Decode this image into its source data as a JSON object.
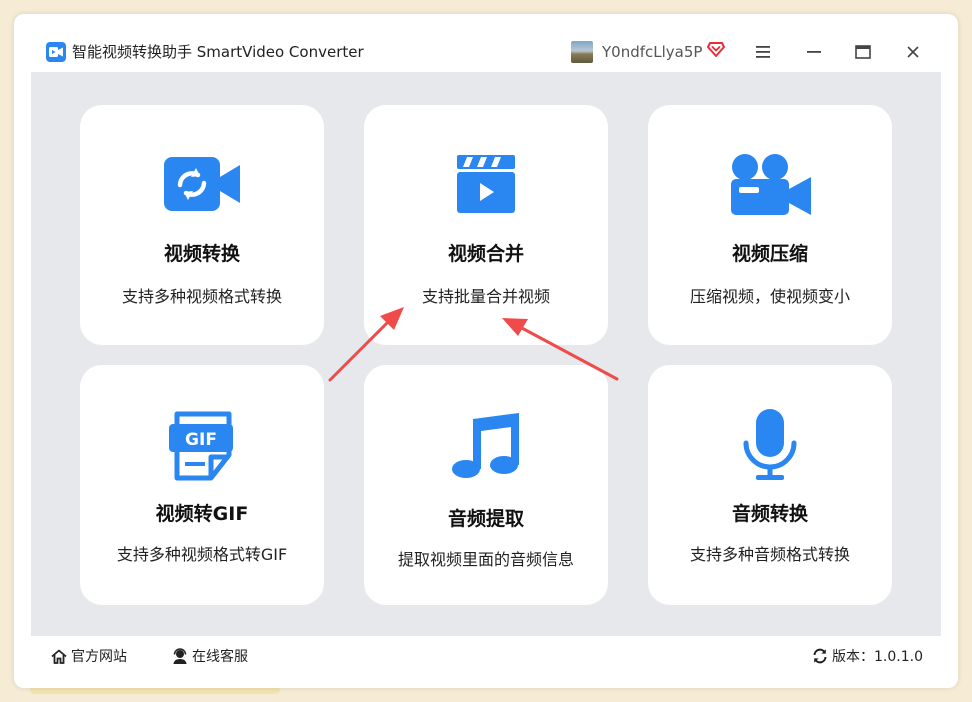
{
  "app": {
    "title": "智能视频转换助手 SmartVideo Converter",
    "username": "Y0ndfcLlya5P"
  },
  "window_controls": {
    "menu": "menu-icon",
    "minimize": "minimize-icon",
    "maximize": "maximize-icon",
    "close": "close-icon"
  },
  "features": [
    {
      "title": "视频转换",
      "desc": "支持多种视频格式转换",
      "icon": "video-convert-icon"
    },
    {
      "title": "视频合并",
      "desc": "支持批量合并视频",
      "icon": "video-merge-icon"
    },
    {
      "title": "视频压缩",
      "desc": "压缩视频，使视频变小",
      "icon": "video-camera-icon"
    },
    {
      "title": "视频转GIF",
      "desc": "支持多种视频格式转GIF",
      "icon": "gif-icon"
    },
    {
      "title": "音频提取",
      "desc": "提取视频里面的音频信息",
      "icon": "music-note-icon"
    },
    {
      "title": "音频转换",
      "desc": "支持多种音频格式转换",
      "icon": "microphone-icon"
    }
  ],
  "footer": {
    "website": "官方网站",
    "support": "在线客服",
    "version": "版本：1.0.1.0"
  },
  "colors": {
    "accent": "#2a86f0",
    "content_bg": "#e7e8ec",
    "annotation_arrow": "#f04b4b"
  }
}
